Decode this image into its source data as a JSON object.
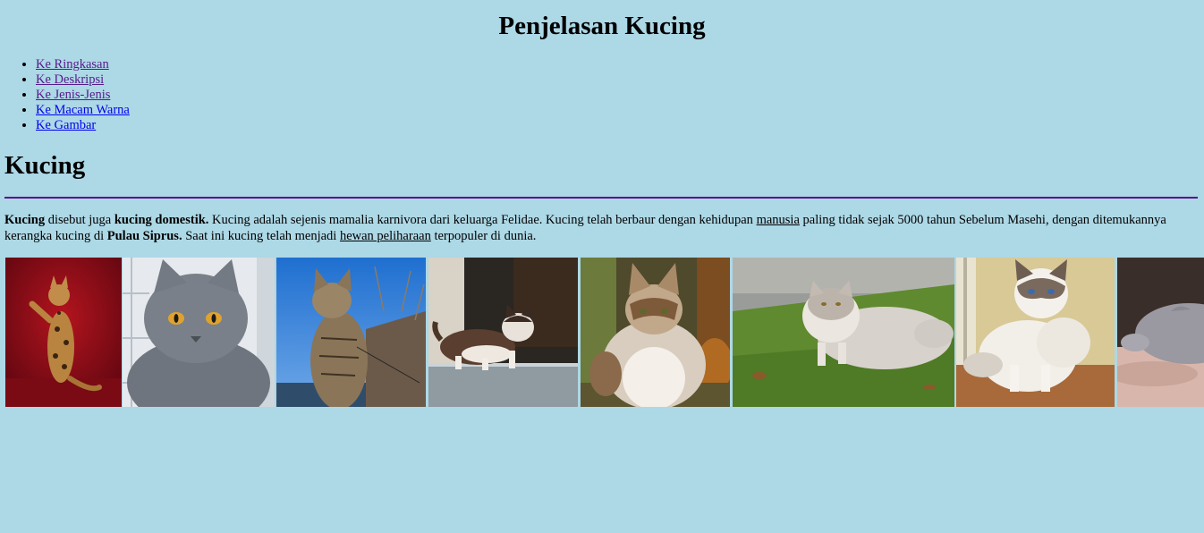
{
  "page_title": "Penjelasan Kucing",
  "nav": [
    {
      "label": "Ke Ringkasan",
      "visited": true
    },
    {
      "label": "Ke Deskripsi",
      "visited": true
    },
    {
      "label": "Ke Jenis-Jenis",
      "visited": true
    },
    {
      "label": "Ke Macam Warna",
      "visited": false
    },
    {
      "label": "Ke Gambar",
      "visited": false
    }
  ],
  "section_title": "Kucing",
  "desc": {
    "t1": "Kucing",
    "t2": " disebut juga ",
    "t3": "kucing domestik.",
    "t4": " Kucing adalah sejenis mamalia karnivora dari keluarga Felidae. Kucing telah berbaur dengan kehidupan ",
    "t5": "manusia",
    "t6": " paling tidak sejak 5000 tahun Sebelum Masehi, dengan ditemukannya kerangka kucing di ",
    "t7": "Pulau Siprus.",
    "t8": " Saat ini kucing telah menjadi ",
    "t9": "hewan peliharaan",
    "t10": " terpopuler di dunia."
  },
  "colors": {
    "background": "#add8e6",
    "visited_link": "#551a8b",
    "unvisited_link": "#0000ee",
    "divider": "#5b0a8c"
  },
  "gallery_icons": [
    "bengal-cat-photo",
    "british-shorthair-photo",
    "maine-coon-photo",
    "munchkin-cat-photo",
    "norwegian-forest-cat-photo",
    "persian-cat-photo",
    "ragdoll-cat-photo",
    "scottish-fold-photo"
  ]
}
